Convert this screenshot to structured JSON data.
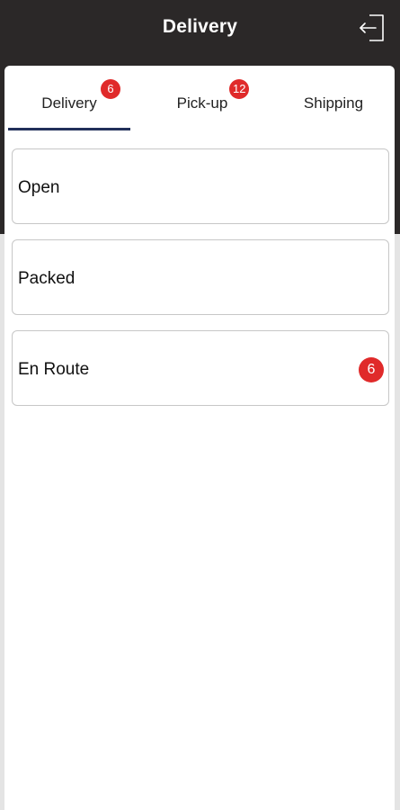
{
  "header": {
    "title": "Delivery",
    "logout_icon": "logout-icon"
  },
  "tabs": [
    {
      "label": "Delivery",
      "badge": "6",
      "active": true
    },
    {
      "label": "Pick-up",
      "badge": "12",
      "active": false
    },
    {
      "label": "Shipping",
      "badge": null,
      "active": false
    }
  ],
  "statuses": [
    {
      "label": "Open",
      "badge": null
    },
    {
      "label": "Packed",
      "badge": null
    },
    {
      "label": "En Route",
      "badge": "6"
    }
  ],
  "colors": {
    "header_bg": "#2b2828",
    "badge": "#e02a2a",
    "active_tab_indicator": "#22305a"
  }
}
